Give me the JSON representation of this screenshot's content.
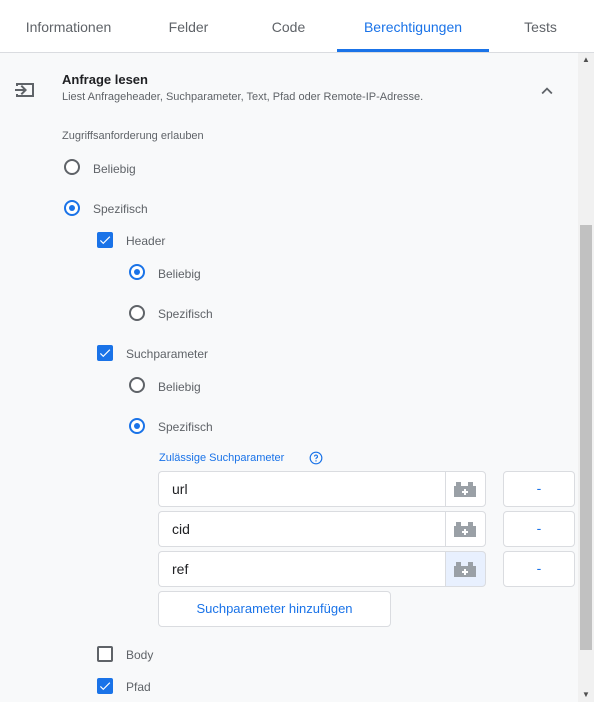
{
  "tabs": [
    {
      "label": "Informationen"
    },
    {
      "label": "Felder"
    },
    {
      "label": "Code"
    },
    {
      "label": "Berechtigungen",
      "active": true
    },
    {
      "label": "Tests"
    }
  ],
  "section": {
    "title": "Anfrage lesen",
    "subtitle": "Liest Anfrageheader, Suchparameter, Text, Pfad oder Remote-IP-Adresse.",
    "icon": "input-icon",
    "collapse_icon": "chevron-up-icon"
  },
  "access": {
    "label": "Zugriffsanforderung erlauben",
    "options": [
      {
        "label": "Beliebig",
        "checked": false
      },
      {
        "label": "Spezifisch",
        "checked": true
      }
    ]
  },
  "header": {
    "label": "Header",
    "checked": true,
    "options": [
      {
        "label": "Beliebig",
        "checked": true
      },
      {
        "label": "Spezifisch",
        "checked": false
      }
    ]
  },
  "query": {
    "label": "Suchparameter",
    "checked": true,
    "options": [
      {
        "label": "Beliebig",
        "checked": false
      },
      {
        "label": "Spezifisch",
        "checked": true
      }
    ],
    "allowed_label": "Zulässige Suchparameter",
    "params": [
      {
        "value": "url",
        "remove_label": "-"
      },
      {
        "value": "cid",
        "remove_label": "-"
      },
      {
        "value": "ref",
        "remove_label": "-"
      }
    ],
    "add_label": "Suchparameter hinzufügen"
  },
  "body": {
    "label": "Body",
    "checked": false
  },
  "path": {
    "label": "Pfad",
    "checked": true
  },
  "colors": {
    "accent": "#1a73e8",
    "background": "#f8f9fa"
  }
}
